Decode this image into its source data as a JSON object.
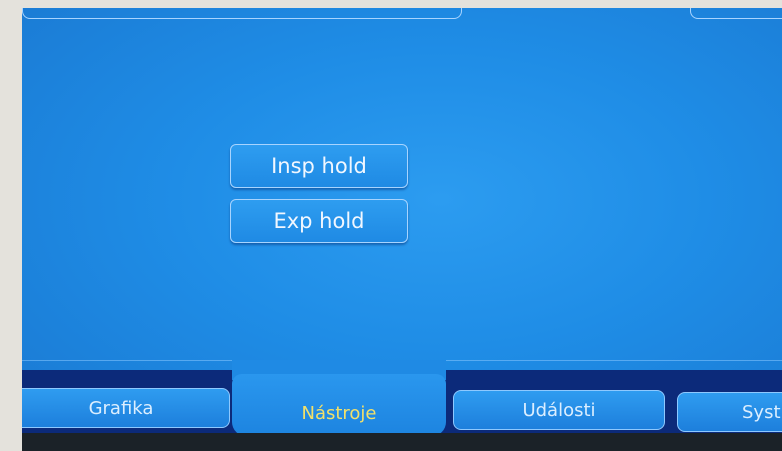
{
  "buttons": {
    "insp_hold": "Insp hold",
    "exp_hold": "Exp hold"
  },
  "tabs": [
    {
      "label": "Grafika",
      "active": false
    },
    {
      "label": "Nástroje",
      "active": true
    },
    {
      "label": "Události",
      "active": false
    },
    {
      "label": "Syst",
      "active": false
    }
  ],
  "colors": {
    "screen_blue": "#1f8de6",
    "active_tab_text": "#f2e06a",
    "tab_strip": "#0c2a7a"
  }
}
